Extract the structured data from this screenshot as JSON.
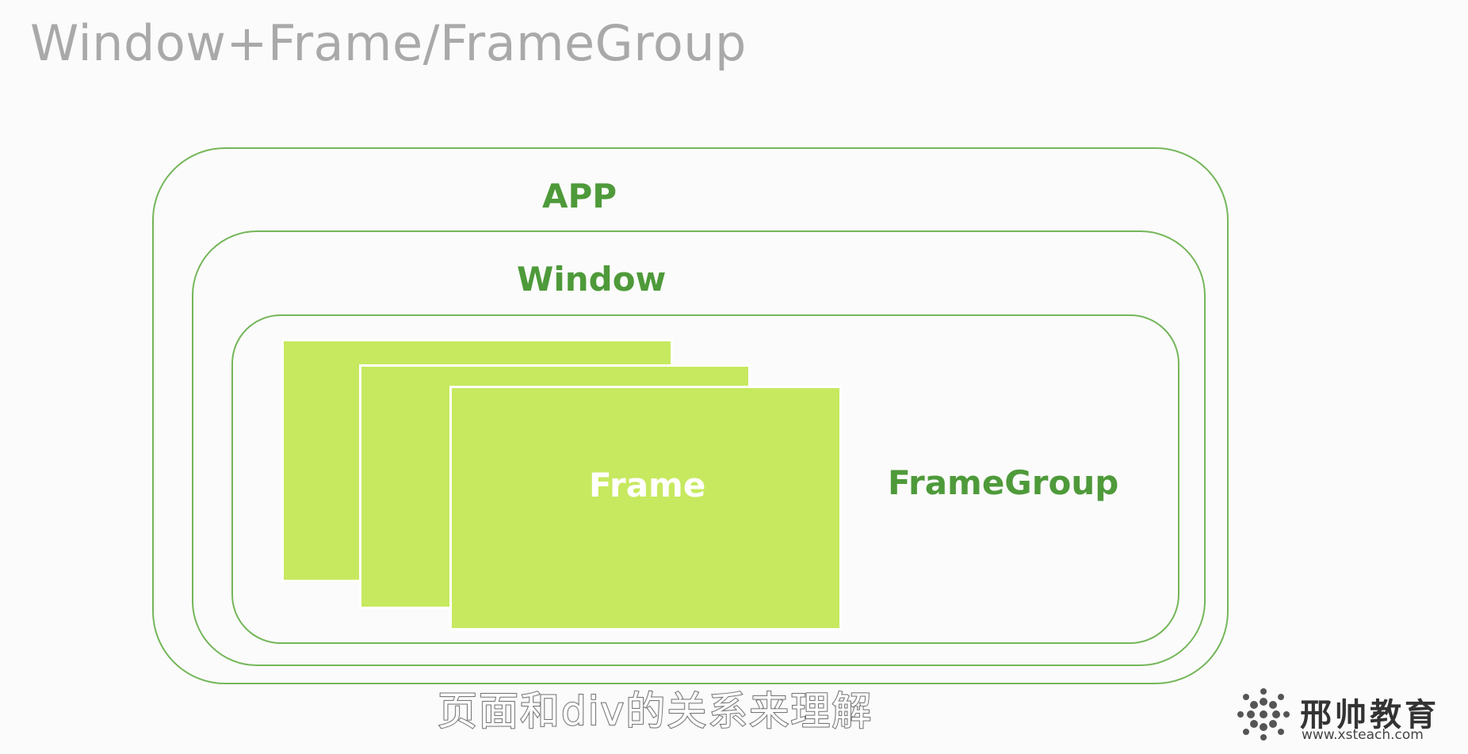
{
  "page": {
    "title": "Window+Frame/FrameGroup"
  },
  "diagram": {
    "app_label": "APP",
    "window_label": "Window",
    "frame_label": "Frame",
    "group_label": "FrameGroup"
  },
  "subtitle": "页面和div的关系来理解",
  "brand": {
    "name": "邢帅教育",
    "url": "www.xsteach.com",
    "icon": "asterisk-logo-icon"
  },
  "colors": {
    "outline": "#74b659",
    "label": "#4e9a3a",
    "frame_fill": "#c7e95f",
    "title": "#a9a9a9"
  }
}
